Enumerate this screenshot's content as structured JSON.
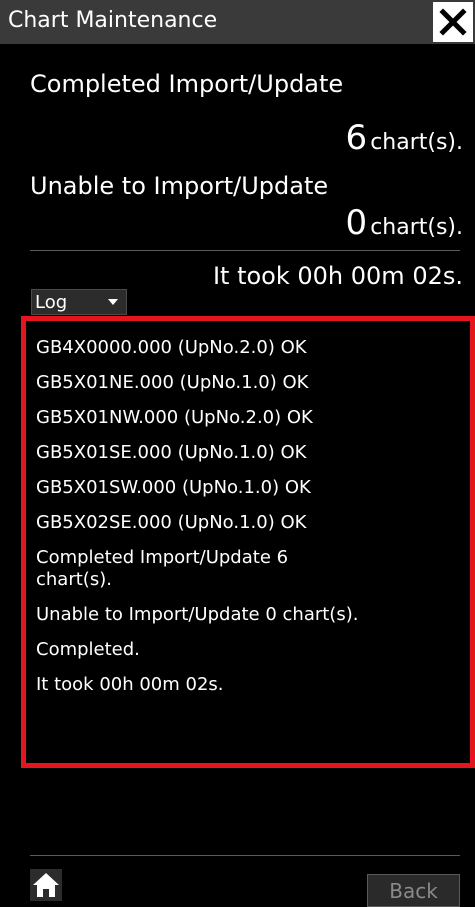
{
  "window": {
    "title": "Chart Maintenance"
  },
  "summary": {
    "completed_label": "Completed Import/Update",
    "completed_count": "6",
    "completed_unit": "chart(s).",
    "unable_label": "Unable to Import/Update",
    "unable_count": "0",
    "unable_unit": "chart(s).",
    "elapsed": "It took 00h 00m 02s."
  },
  "log_select": {
    "selected": "Log"
  },
  "log": {
    "lines": [
      "GB4X0000.000 (UpNo.2.0) OK",
      "GB5X01NE.000 (UpNo.1.0) OK",
      "GB5X01NW.000 (UpNo.2.0) OK",
      "GB5X01SE.000 (UpNo.1.0) OK",
      "GB5X01SW.000 (UpNo.1.0) OK",
      "GB5X02SE.000 (UpNo.1.0) OK",
      "Completed Import/Update 6\nchart(s).",
      "Unable to Import/Update 0 chart(s).",
      "Completed.",
      "It took 00h 00m 02s."
    ]
  },
  "footer": {
    "back_label": "Back"
  },
  "colors": {
    "highlight_border": "#e4151f",
    "titlebar": "#3a3a3a",
    "background": "#000000"
  },
  "icons": {
    "close": "close-icon",
    "home": "home-icon",
    "dropdown": "chevron-down-icon"
  }
}
